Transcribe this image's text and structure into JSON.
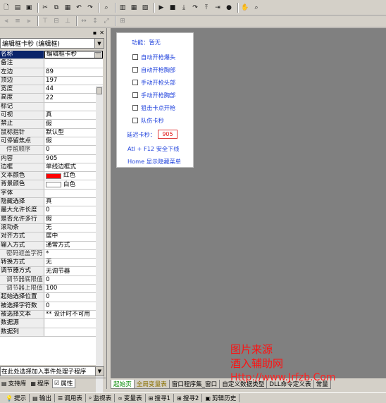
{
  "toolbar_top": {
    "buttons": [
      "new-file-icon",
      "open-folder-icon",
      "save-icon",
      "cut-icon",
      "copy-icon",
      "paste-icon",
      "undo-icon",
      "redo-icon",
      "find-icon",
      "layout-a-icon",
      "layout-b-icon",
      "layout-c-icon",
      "play-icon",
      "stop-icon",
      "step-into-icon",
      "step-over-icon",
      "step-out-icon",
      "run-to-cursor-icon",
      "breakpoint-icon",
      "hand-icon",
      "search-icon"
    ]
  },
  "toolbar_align": {
    "buttons": [
      "align-left-icon",
      "align-center-icon",
      "align-right-icon",
      "align-top-icon",
      "align-middle-icon",
      "align-bottom-icon",
      "same-width-icon",
      "same-height-icon",
      "same-size-icon",
      "grid-icon"
    ]
  },
  "property_panel": {
    "component_combo": "编辑框卡秒 (编辑框)",
    "properties": [
      {
        "name": "名称",
        "value": "编辑框卡秒",
        "selected": true
      },
      {
        "name": "备注",
        "value": ""
      },
      {
        "name": "左边",
        "value": "89"
      },
      {
        "name": "顶边",
        "value": "197"
      },
      {
        "name": "宽度",
        "value": "44"
      },
      {
        "name": "高度",
        "value": "22"
      },
      {
        "name": "标记",
        "value": ""
      },
      {
        "name": "可视",
        "value": "真"
      },
      {
        "name": "禁止",
        "value": "假"
      },
      {
        "name": "鼠标指针",
        "value": "默认型"
      },
      {
        "name": "可停留焦点",
        "value": "假"
      },
      {
        "name": "停留顺序",
        "value": "0",
        "sub": true
      },
      {
        "name": "内容",
        "value": "905"
      },
      {
        "name": "边框",
        "value": "单线边框式"
      },
      {
        "name": "文本颜色",
        "value": "红色",
        "swatch": "#ff0000"
      },
      {
        "name": "背景颜色",
        "value": "白色",
        "swatch": "#ffffff"
      },
      {
        "name": "字体",
        "value": ""
      },
      {
        "name": "隐藏选择",
        "value": "真"
      },
      {
        "name": "最大允许长度",
        "value": "0"
      },
      {
        "name": "是否允许多行",
        "value": "假"
      },
      {
        "name": "滚动条",
        "value": "无"
      },
      {
        "name": "对齐方式",
        "value": "居中"
      },
      {
        "name": "输入方式",
        "value": "通常方式"
      },
      {
        "name": "密码遮盖字符",
        "value": "*",
        "sub": true
      },
      {
        "name": "转换方式",
        "value": "无"
      },
      {
        "name": "调节器方式",
        "value": "无调节器"
      },
      {
        "name": "调节器底限值",
        "value": "0",
        "sub": true
      },
      {
        "name": "调节器上限值",
        "value": "100",
        "sub": true
      },
      {
        "name": "起始选择位置",
        "value": "0"
      },
      {
        "name": "被选择字符数",
        "value": "0"
      },
      {
        "name": "被选择文本",
        "value": "** 设计时不可用"
      },
      {
        "name": "数据源",
        "value": ""
      },
      {
        "name": "数据列",
        "value": ""
      }
    ],
    "event_combo": "在此处选择加入事件处理子程序",
    "tabs": [
      {
        "label": "支持库",
        "icon": "library-icon"
      },
      {
        "label": "程序",
        "icon": "program-icon"
      },
      {
        "label": "属性",
        "icon": "properties-icon",
        "active": true
      }
    ]
  },
  "form": {
    "title": "功能：暂无",
    "checkboxes": [
      "自动开枪爆头",
      "自动开枪胸部",
      "手动开枪头部",
      "手动开枪胸部",
      "狙击卡点开枪",
      "队伤卡秒"
    ],
    "delay_label": "延迟卡秒：",
    "delay_value": "905",
    "hint_exit": "Atl + F12 安全下线",
    "hint_menu": "Home 显示隐藏菜单"
  },
  "doc_tabs": [
    "起始页",
    "全局变量表",
    "窗口程序集_窗口",
    "自定义数据类型",
    "DLL命令定义表",
    "常量"
  ],
  "output_tabs": [
    {
      "label": "提示",
      "icon": "tip-icon"
    },
    {
      "label": "输出",
      "icon": "output-icon"
    },
    {
      "label": "调用表",
      "icon": "callstack-icon"
    },
    {
      "label": "监视表",
      "icon": "watch-icon"
    },
    {
      "label": "变量表",
      "icon": "variables-icon"
    },
    {
      "label": "搜寻1",
      "icon": "search1-icon"
    },
    {
      "label": "搜寻2",
      "icon": "search2-icon"
    },
    {
      "label": "剪辑历史",
      "icon": "clip-history-icon"
    }
  ],
  "watermark": {
    "line1": "图片来源",
    "line2": "酒入辅助网",
    "line3": "Http://www.Jrfzb.Com"
  },
  "colors": {
    "selection": "#0a246a",
    "form_text": "#2244dd",
    "watermark": "#ff1010",
    "canvas": "#808080"
  }
}
